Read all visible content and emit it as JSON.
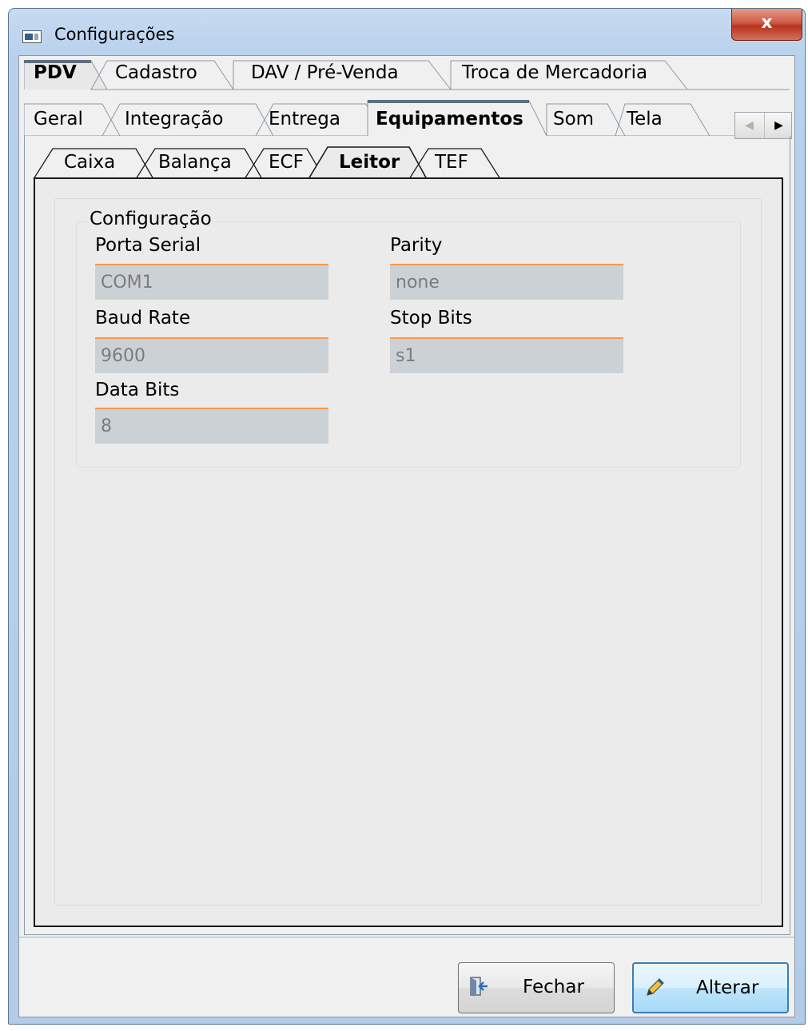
{
  "window": {
    "title": "Configurações",
    "close_label": "x"
  },
  "tabs_level1": [
    {
      "label": "PDV",
      "active": true
    },
    {
      "label": "Cadastro",
      "active": false
    },
    {
      "label": "DAV / Pré-Venda",
      "active": false
    },
    {
      "label": "Troca de Mercadoria",
      "active": false
    }
  ],
  "tabs_level2": [
    {
      "label": "Geral",
      "active": false
    },
    {
      "label": "Integração",
      "active": false
    },
    {
      "label": "Entrega",
      "active": false
    },
    {
      "label": "Equipamentos",
      "active": true
    },
    {
      "label": "Som",
      "active": false
    },
    {
      "label": "Tela",
      "active": false
    }
  ],
  "tabs_level3": [
    {
      "label": "Caixa",
      "active": false
    },
    {
      "label": "Balança",
      "active": false
    },
    {
      "label": "ECF",
      "active": false
    },
    {
      "label": "Leitor",
      "active": true
    },
    {
      "label": "TEF",
      "active": false
    }
  ],
  "tab_scroll": {
    "left_icon": "arrow-left-icon",
    "right_icon": "arrow-right-icon",
    "left_glyph": "◀",
    "right_glyph": "▶"
  },
  "group": {
    "title": "Configuração",
    "fields": {
      "porta_serial": {
        "label": "Porta Serial",
        "value": "COM1"
      },
      "baud_rate": {
        "label": "Baud Rate",
        "value": "9600"
      },
      "data_bits": {
        "label": "Data Bits",
        "value": "8"
      },
      "parity": {
        "label": "Parity",
        "value": "none"
      },
      "stop_bits": {
        "label": "Stop Bits",
        "value": "s1"
      }
    }
  },
  "footer": {
    "close_button": {
      "label": "Fechar",
      "icon": "exit-door-icon"
    },
    "edit_button": {
      "label": "Alterar",
      "icon": "pencil-icon"
    }
  },
  "colors": {
    "input_accent": "#f59a4c",
    "input_background": "#ccd1d6",
    "window_frame": "#b9d1ec",
    "close_button": "#c8412a"
  }
}
